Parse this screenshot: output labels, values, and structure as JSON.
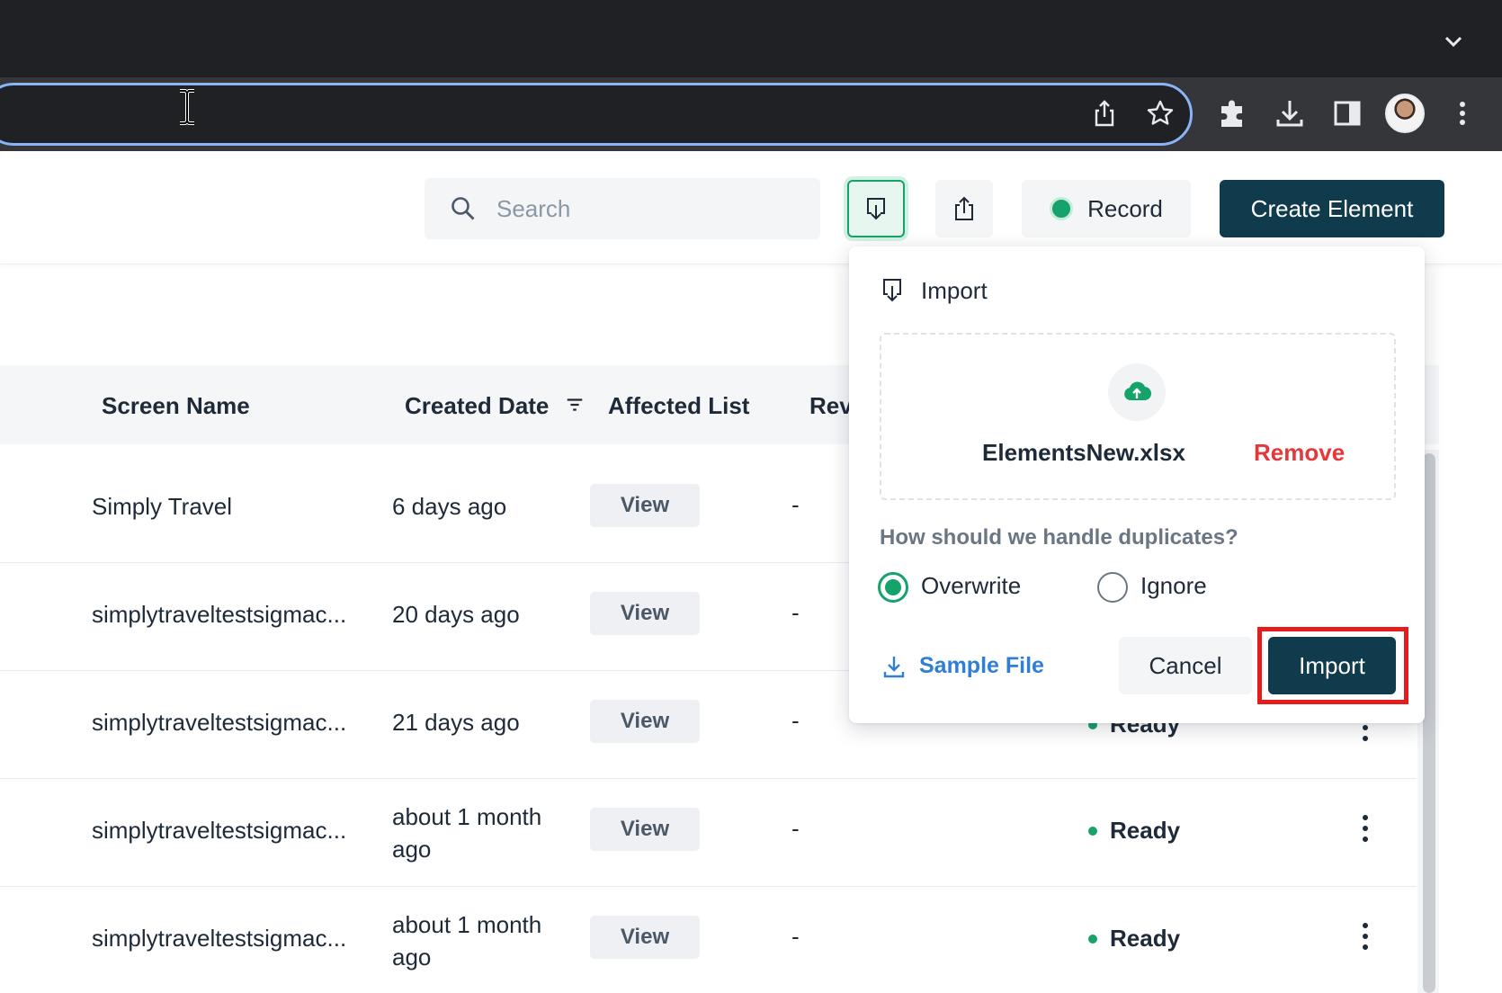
{
  "header": {
    "search_placeholder": "Search",
    "record_label": "Record",
    "create_label": "Create Element"
  },
  "table": {
    "columns": [
      "Screen Name",
      "Created Date",
      "Affected List",
      "Rev"
    ],
    "view_label": "View",
    "rows": [
      {
        "name": "Simply Travel",
        "created": "6 days ago",
        "rev": "-",
        "status": ""
      },
      {
        "name": "simplytraveltestsigmac...",
        "created": "20 days ago",
        "rev": "-",
        "status": ""
      },
      {
        "name": "simplytraveltestsigmac...",
        "created": "21 days ago",
        "rev": "-",
        "status": "Ready"
      },
      {
        "name": "simplytraveltestsigmac...",
        "created": "about 1 month ago",
        "rev": "-",
        "status": "Ready"
      },
      {
        "name": "simplytraveltestsigmac...",
        "created": "about 1 month ago",
        "rev": "-",
        "status": "Ready"
      }
    ]
  },
  "import_popover": {
    "title": "Import",
    "file_name": "ElementsNew.xlsx",
    "remove_label": "Remove",
    "duplicates_question": "How should we handle duplicates?",
    "options": [
      "Overwrite",
      "Ignore"
    ],
    "selected_option": "Overwrite",
    "sample_file_label": "Sample File",
    "cancel_label": "Cancel",
    "import_label": "Import"
  },
  "colors": {
    "primary": "#0f3b4c",
    "accent_green": "#16a36b",
    "danger": "#e5383b",
    "link": "#2f7fd6",
    "highlight": "#e51c1c"
  }
}
